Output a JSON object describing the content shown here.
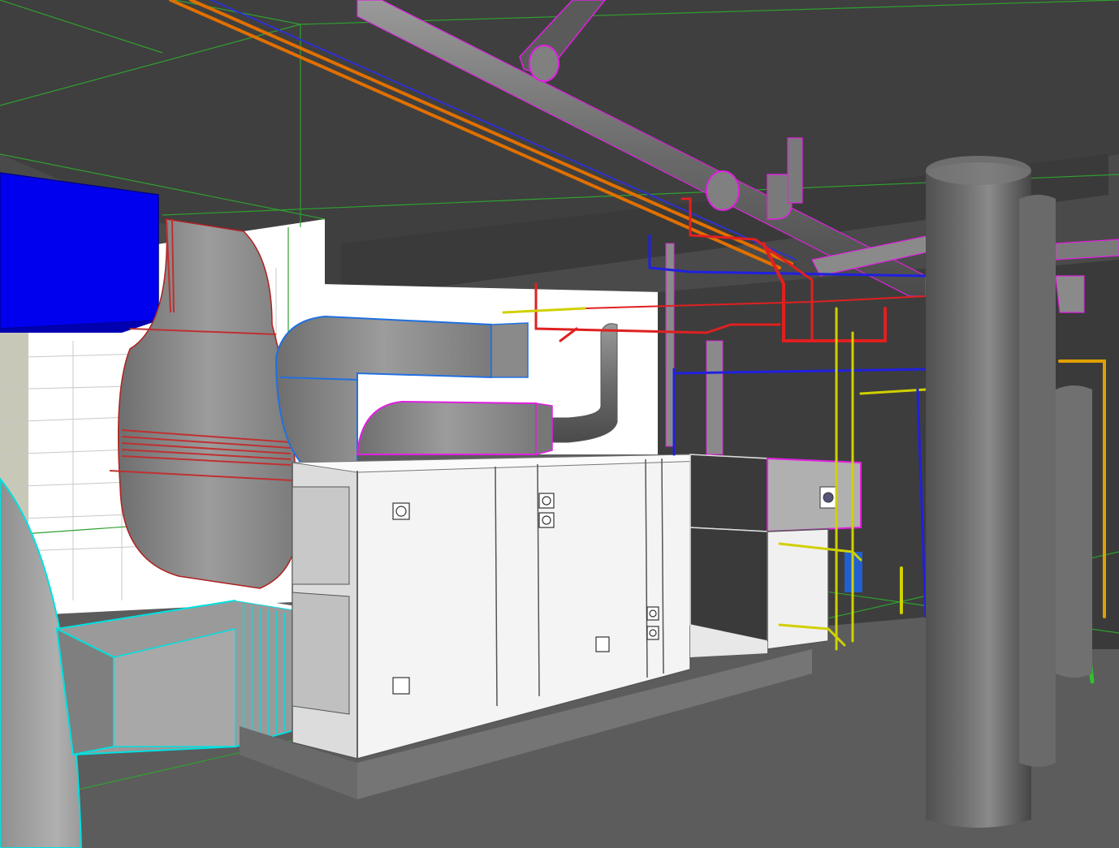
{
  "scene": {
    "type": "3d-mep-model-view",
    "colors": {
      "background": "#4a4a4a",
      "ceiling": "#3f3f3f",
      "floor": "#5c5c5c",
      "wall_block": "#ffffff",
      "duct_gray": "#8e8e8e",
      "supply_blue": "#0000ee",
      "pipe_magenta": "#e020e0",
      "pipe_orange": "#e07000",
      "pipe_red": "#e02020",
      "pipe_blue": "#2020e0",
      "pipe_yellow": "#d0d000",
      "pipe_green": "#30c030",
      "pipe_cyan": "#00e0e0",
      "grid_green": "#2fa02f",
      "ahu_body": "#f4f4f4",
      "column": "#6a6a6a"
    },
    "elements": [
      "blue-supply-duct",
      "gray-transition-duct",
      "cyan-flex-connector-duct",
      "upper-elbow-duct",
      "lower-elbow-duct",
      "air-handling-unit",
      "coil-section",
      "structural-column",
      "overhead-piping"
    ]
  }
}
